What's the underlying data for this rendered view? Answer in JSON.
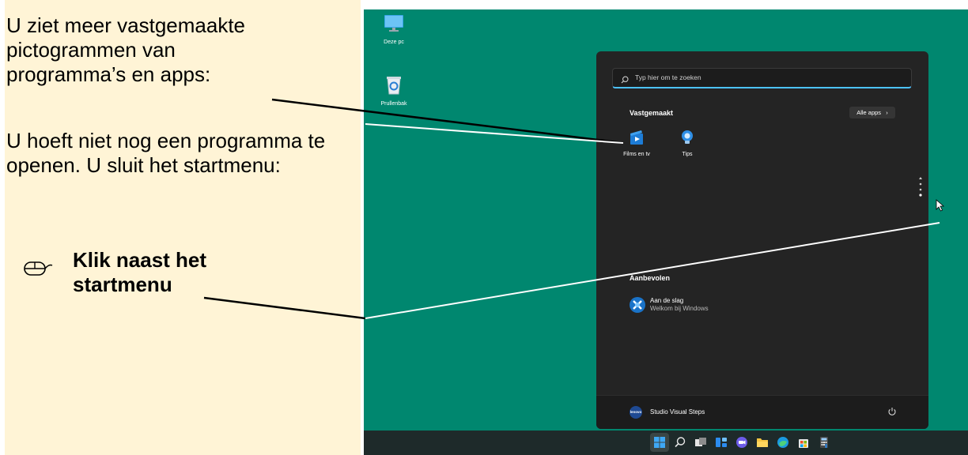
{
  "instructions": {
    "para1": "U ziet meer vastgemaakte pictogrammen van programma’s en apps:",
    "para2": "U hoeft niet nog een programma te openen. U sluit het startmenu:",
    "action": "Klik naast het startmenu",
    "action_icon": "mouse-icon"
  },
  "desktop": {
    "background": "#00876f",
    "icons": [
      {
        "label": "Deze pc",
        "icon": "monitor-icon"
      },
      {
        "label": "Prullenbak",
        "icon": "recycle-bin-icon"
      }
    ]
  },
  "startmenu": {
    "search_placeholder": "Typ hier om te zoeken",
    "pinned_title": "Vastgemaakt",
    "all_apps_label": "Alle apps",
    "pinned_apps": [
      {
        "label": "Films en tv",
        "icon": "films-tv-icon"
      },
      {
        "label": "Tips",
        "icon": "tips-icon"
      }
    ],
    "recommended_title": "Aanbevolen",
    "recommended_items": [
      {
        "title": "Aan de slag",
        "subtitle": "Welkom bij Windows",
        "icon": "get-started-icon"
      }
    ],
    "user": {
      "avatar_text": "lenovo",
      "name": "Studio Visual Steps"
    },
    "power_icon": "power-icon"
  },
  "taskbar": {
    "icons": [
      "windows-start-icon",
      "search-icon",
      "task-view-icon",
      "widgets-icon",
      "chat-icon",
      "file-explorer-icon",
      "edge-icon",
      "store-icon",
      "calculator-icon"
    ]
  },
  "colors": {
    "panel_bg": "#fff4d6",
    "accent": "#4cc2ff",
    "menu_bg": "#242424"
  }
}
